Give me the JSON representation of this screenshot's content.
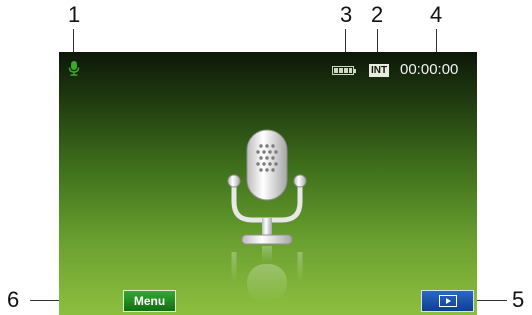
{
  "callouts": {
    "c1": "1",
    "c2": "2",
    "c3": "3",
    "c4": "4",
    "c5": "5",
    "c6": "6"
  },
  "screen": {
    "timer": "00:00:00",
    "storage_badge": "INT",
    "menu_label": "Menu",
    "icons": {
      "status_mic": "microphone-icon",
      "battery": "battery-icon",
      "center": "microphone-icon",
      "playback": "playback-icon"
    },
    "battery_level": 1.0
  },
  "colors": {
    "status_mic": "#3ba82a",
    "menu_button": "#1a8a1a",
    "play_button": "#1e56b0"
  }
}
